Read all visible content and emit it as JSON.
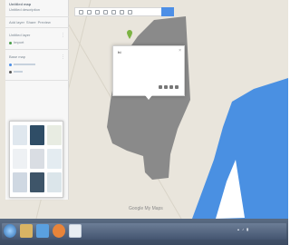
{
  "window": {
    "title": ""
  },
  "panel": {
    "header_title": "Untitled map",
    "header_sub": "Untitled description",
    "menu_items": [
      "Add layer",
      "Share",
      "Preview"
    ],
    "layer_title": "Untitled layer",
    "layer_row": "Import",
    "base_title": "Base map",
    "icons": [
      "kebab-menu-icon",
      "layer-dot-icon"
    ]
  },
  "search": {
    "placeholder": ""
  },
  "popup": {
    "title": "hi",
    "description": "",
    "footer": "",
    "tools": [
      "style-icon",
      "edit-icon",
      "filter-icon",
      "delete-icon"
    ]
  },
  "map": {
    "logo": "Google My Maps",
    "copyright": "",
    "colors": {
      "land": "#e9e5dc",
      "polygon": "#8a8a8a",
      "water": "#4a90e2",
      "marker": "#7cb342",
      "accent": "#4d8fe6"
    }
  },
  "taskbar": {
    "apps": [
      "start-button",
      "explorer-icon",
      "media-icon",
      "firefox-icon",
      "chrome-icon"
    ],
    "tray_icons": [
      "network-icon",
      "volume-icon",
      "battery-icon"
    ],
    "clock": ""
  }
}
